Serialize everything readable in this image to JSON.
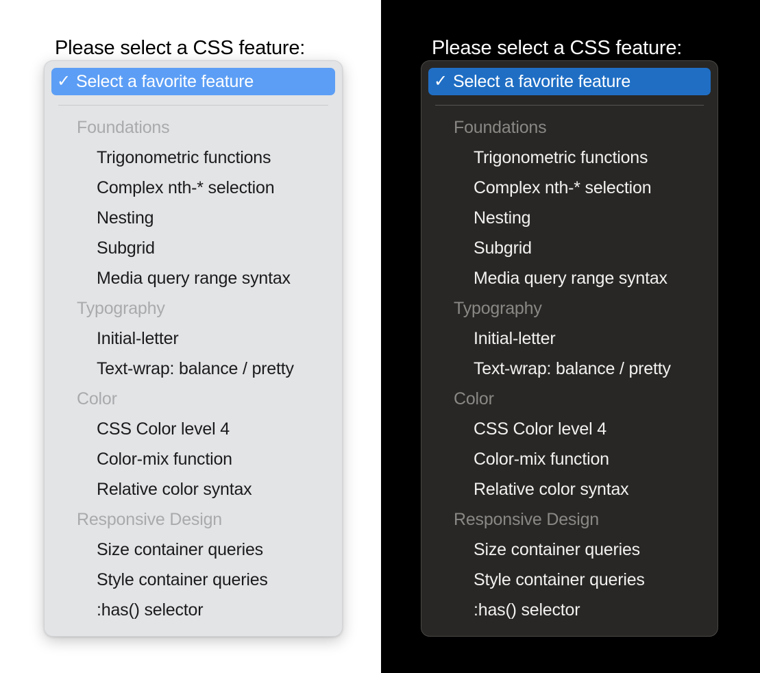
{
  "prompt_label": "Please select a CSS feature:",
  "selected_option": {
    "label": "Select a favorite feature",
    "check_icon": "✓"
  },
  "colors": {
    "light_pane_background": "#ffffff",
    "dark_pane_background": "#000000",
    "light_popup_background": "#e3e4e6",
    "dark_popup_background": "#282725",
    "light_highlight": "#5c9ef5",
    "dark_highlight": "#1f6ec4",
    "light_group_label": "#a9aaac",
    "dark_group_label": "#8a8885",
    "light_option_text": "#1b1b1d",
    "dark_option_text": "#f2f1ef"
  },
  "groups": [
    {
      "label": "Foundations",
      "options": [
        "Trigonometric functions",
        "Complex nth-* selection",
        "Nesting",
        "Subgrid",
        "Media query range syntax"
      ]
    },
    {
      "label": "Typography",
      "options": [
        "Initial-letter",
        "Text-wrap: balance / pretty"
      ]
    },
    {
      "label": "Color",
      "options": [
        "CSS Color level 4",
        "Color-mix function",
        "Relative color syntax"
      ]
    },
    {
      "label": "Responsive Design",
      "options": [
        "Size container queries",
        "Style container queries",
        ":has() selector"
      ]
    }
  ]
}
